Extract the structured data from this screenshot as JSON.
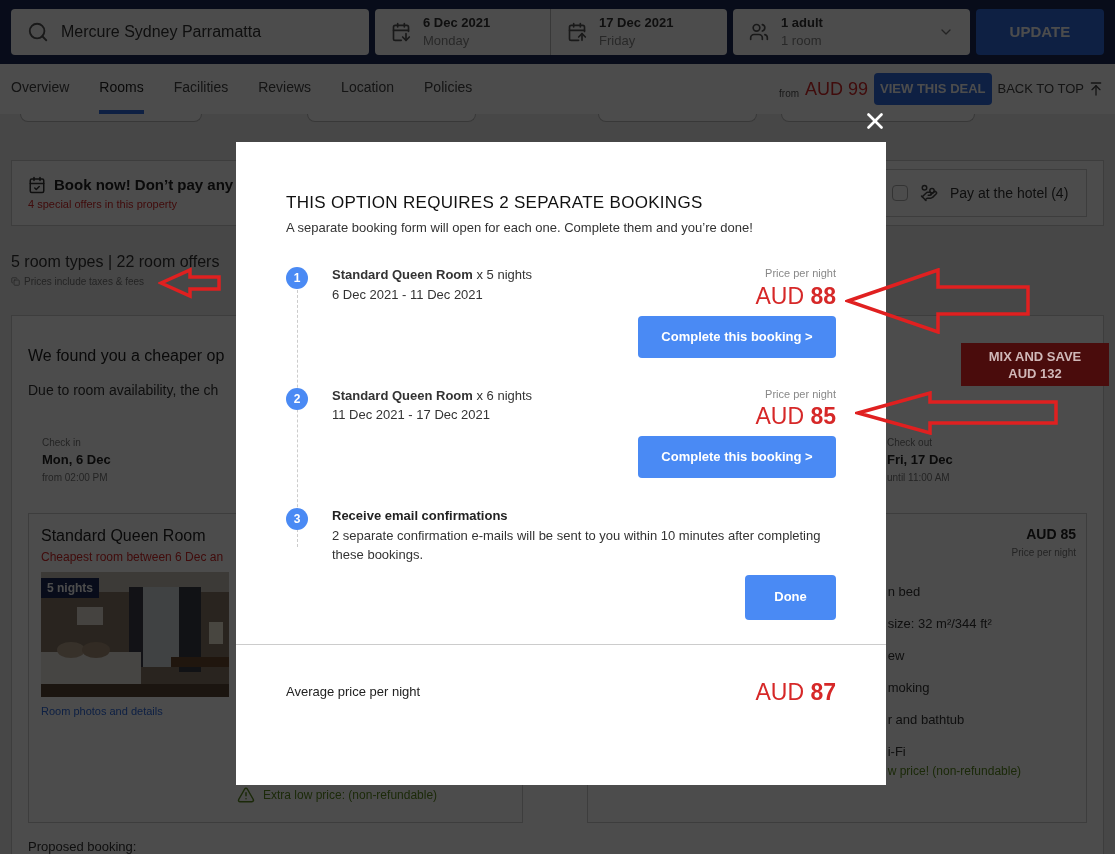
{
  "search_bar": {
    "hotel": "Mercure Sydney Parramatta",
    "check_in": {
      "date": "6 Dec 2021",
      "day": "Monday"
    },
    "check_out": {
      "date": "17 Dec 2021",
      "day": "Friday"
    },
    "guests": {
      "adults": "1 adult",
      "rooms": "1 room"
    },
    "update_button": "UPDATE"
  },
  "nav_tabs": [
    {
      "label": "Overview",
      "selected": false
    },
    {
      "label": "Rooms",
      "selected": true
    },
    {
      "label": "Facilities",
      "selected": false
    },
    {
      "label": "Reviews",
      "selected": false
    },
    {
      "label": "Location",
      "selected": false
    },
    {
      "label": "Policies",
      "selected": false
    }
  ],
  "deal": {
    "from_label": "from",
    "price": "AUD 99",
    "button": "VIEW THIS DEAL",
    "back_to_top": "BACK TO TOP"
  },
  "promo": {
    "title": "Book now! Don’t pay any",
    "subtitle": "4 special offers in this property",
    "filter": {
      "label": "Pay at the hotel (4)",
      "checked": false
    }
  },
  "summary": {
    "counts": "5 room types | 22 room offers",
    "note": "Prices include taxes & fees"
  },
  "cheaper_option": {
    "title": "We found you a cheaper op",
    "description": "Due to room availability, the ch",
    "badge_lines": [
      "MIX AND SAVE",
      "AUD 132"
    ],
    "check_in": {
      "label": "Check in",
      "date": "Mon, 6 Dec",
      "time": "from 02:00 PM"
    },
    "check_out": {
      "label": "Check out",
      "date": "Fri, 17 Dec",
      "time": "until 11:00 AM"
    },
    "room_card": {
      "title": "Standard Queen Room",
      "subtitle": "Cheapest room between 6 Dec an",
      "photo_badge": "5 nights",
      "link": "Room photos and details",
      "deal_note": "Extra low price: (non-refundable)"
    },
    "offer_card": {
      "price": "AUD 85",
      "price_label": "Price per night",
      "features": [
        "n bed",
        "size: 32 m²/344 ft²",
        "ew",
        "moking",
        "r and bathtub",
        "i-Fi"
      ],
      "deal_note": "w price! (non-refundable)"
    },
    "proposed_label": "Proposed booking:"
  },
  "modal": {
    "title": "THIS OPTION REQUIRES 2 SEPARATE BOOKINGS",
    "subtitle": "A separate booking form will open for each one. Complete them and you’re done!",
    "steps": [
      {
        "kind": "booking",
        "number": "1",
        "room": "**Standard Queen Room** x 5 nights",
        "dates": "6 Dec 2021 - 11 Dec 2021",
        "price_label": "Price per night",
        "price": "AUD **88**",
        "button": "Complete this booking >"
      },
      {
        "kind": "booking",
        "number": "2",
        "room": "**Standard Queen Room** x 6 nights",
        "dates": "11 Dec 2021 - 17 Dec 2021",
        "price_label": "Price per night",
        "price": "AUD **85**",
        "button": "Complete this booking >"
      },
      {
        "kind": "confirmation",
        "number": "3",
        "title": "Receive email confirmations",
        "text": "2 separate confirmation e-mails will be sent to you within 10 minutes after completing these bookings.",
        "button": "Done"
      }
    ],
    "average": {
      "label": "Average price per night",
      "price": "AUD **87**"
    }
  }
}
